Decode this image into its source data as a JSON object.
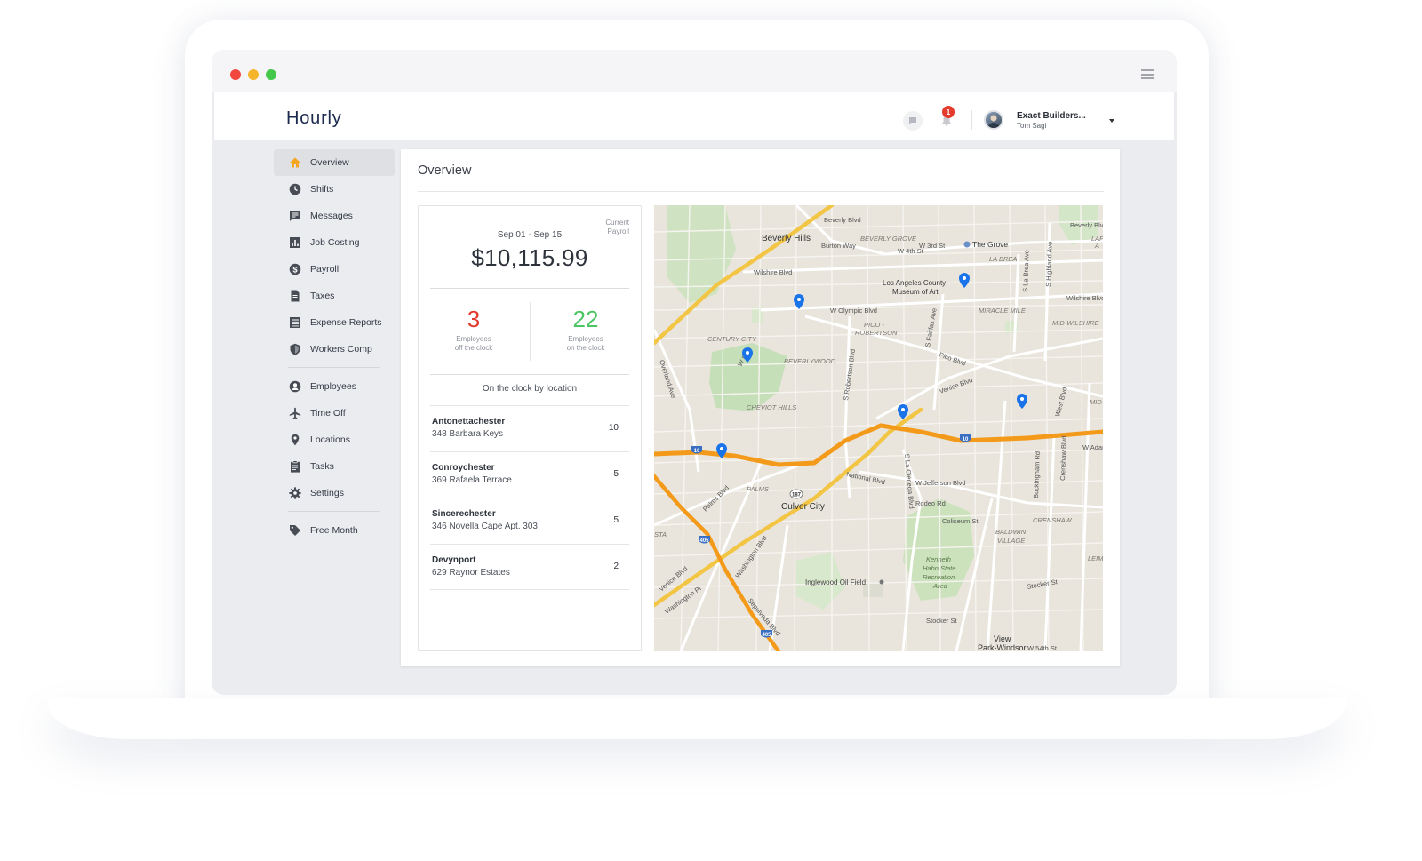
{
  "app": {
    "name": "Hourly"
  },
  "colors": {
    "accent_orange": "#f5a623",
    "negative": "#e0382c",
    "positive": "#4cc562",
    "map_pin": "#1a73e8",
    "notification_badge": "#e53b2f"
  },
  "header": {
    "chat_icon": "chat-bubble-icon",
    "bell_icon": "bell-icon",
    "notification_count": "1",
    "account_name": "Exact Builders...",
    "account_user": "Tom Sagi"
  },
  "sidebar": {
    "groups": [
      [
        {
          "label": "Overview",
          "icon": "home-icon",
          "active": true
        },
        {
          "label": "Shifts",
          "icon": "clock-icon"
        },
        {
          "label": "Messages",
          "icon": "message-icon"
        },
        {
          "label": "Job Costing",
          "icon": "bar-chart-icon"
        },
        {
          "label": "Payroll",
          "icon": "dollar-icon"
        },
        {
          "label": "Taxes",
          "icon": "document-icon"
        },
        {
          "label": "Expense Reports",
          "icon": "list-icon"
        },
        {
          "label": "Workers Comp",
          "icon": "shield-icon"
        }
      ],
      [
        {
          "label": "Employees",
          "icon": "person-icon"
        },
        {
          "label": "Time Off",
          "icon": "airplane-icon"
        },
        {
          "label": "Locations",
          "icon": "location-pin-icon"
        },
        {
          "label": "Tasks",
          "icon": "clipboard-icon"
        },
        {
          "label": "Settings",
          "icon": "gear-icon"
        }
      ],
      [
        {
          "label": "Free Month",
          "icon": "tag-icon"
        }
      ]
    ]
  },
  "overview": {
    "title": "Overview",
    "summary": {
      "current_payroll_label": "Current Payroll",
      "period": "Sep 01 - Sep 15",
      "amount": "$10,115.99",
      "off_clock": {
        "count": "3",
        "label_line1": "Employees",
        "label_line2": "off the clock"
      },
      "on_clock": {
        "count": "22",
        "label_line1": "Employees",
        "label_line2": "on the clock"
      },
      "by_location_label": "On the clock by location",
      "locations": [
        {
          "name": "Antonettachester",
          "address": "348 Barbara Keys",
          "count": "10"
        },
        {
          "name": "Conroychester",
          "address": "369 Rafaela Terrace",
          "count": "5"
        },
        {
          "name": "Sincerechester",
          "address": "346 Novella Cape Apt. 303",
          "count": "5"
        },
        {
          "name": "Devynport",
          "address": "629 Raynor Estates",
          "count": "2"
        }
      ]
    },
    "map": {
      "labels": {
        "beverly_hills": "Beverly Hills",
        "beverly_blvd": "Beverly Blvd",
        "beverly_blvd2": "Beverly Blvd",
        "burton_way": "Burton Way",
        "beverly_grove": "BEVERLY GROVE",
        "w3rd": "W 3rd St",
        "w4th": "W 4th St",
        "the_grove": "The Grove",
        "la_brea": "LA BREA",
        "wilshire_blvd": "Wilshire Blvd",
        "wilshire_blvd2": "Wilshire Blvd",
        "lacma1": "Los Angeles County",
        "lacma2": "Museum of Art",
        "w_olympic": "W Olympic Blvd",
        "miracle_mile": "MIRACLE MILE",
        "mid_wilshire": "MID-WILSHIRE",
        "pico_robertson1": "PICO -",
        "pico_robertson2": "ROBERTSON",
        "century_city": "CENTURY CITY",
        "beverlywood": "BEVERLYWOOD",
        "pico_blvd": "Pico Blvd",
        "w_pico": "W Pico",
        "cheviot_hills": "CHEVIOT HILLS",
        "venice_blvd": "Venice Blvd",
        "mid_city": "MID CIT",
        "w_adams": "W Adams",
        "national_blvd": "National Blvd",
        "w_jefferson": "W Jefferson Blvd",
        "palms": "PALMS",
        "culver_city": "Culver City",
        "rodeo_rd": "Rodeo Rd",
        "coliseum_st": "Coliseum St",
        "crenshaw": "CRENSHAW",
        "baldwin_village1": "BALDWIN",
        "baldwin_village2": "VILLAGE",
        "kenneth_hahn1": "Kenneth",
        "kenneth_hahn2": "Hahn State",
        "kenneth_hahn3": "Recreation",
        "kenneth_hahn4": "Area",
        "inglewood_oil": "Inglewood Oil Field",
        "view_park1": "View",
        "view_park2": "Park-Windsor",
        "w54th": "W 54th St",
        "stocker_st": "Stocker St",
        "stocker_st2": "Stocker St",
        "venice_blvd_sw": "Venice Blvd",
        "washington_pl": "Washington Pl",
        "washington_blvd": "Washington Blvd",
        "sepulveda": "Sepulveda Blvd",
        "overland": "Overland Ave",
        "palms_blvd": "Palms Blvd",
        "robertson": "S Robertson Blvd",
        "fairfax": "S Fairfax Ave",
        "la_cienega": "S La Cienega Blvd",
        "la_brea_ave": "S La Brea Ave",
        "highland": "S Highland Ave",
        "west_blvd": "West Blvd",
        "buckingham": "Buckingham Rd",
        "crenshaw_blvd": "Crenshaw Blvd",
        "i10_a": "10",
        "i10_b": "10",
        "i10_c": "10",
        "i405_a": "405",
        "i405_b": "405",
        "ca187": "187",
        "sta": "STA",
        "leim": "LEIM",
        "lafa": "LAF",
        "a_label": "A"
      },
      "pins": 6
    }
  }
}
